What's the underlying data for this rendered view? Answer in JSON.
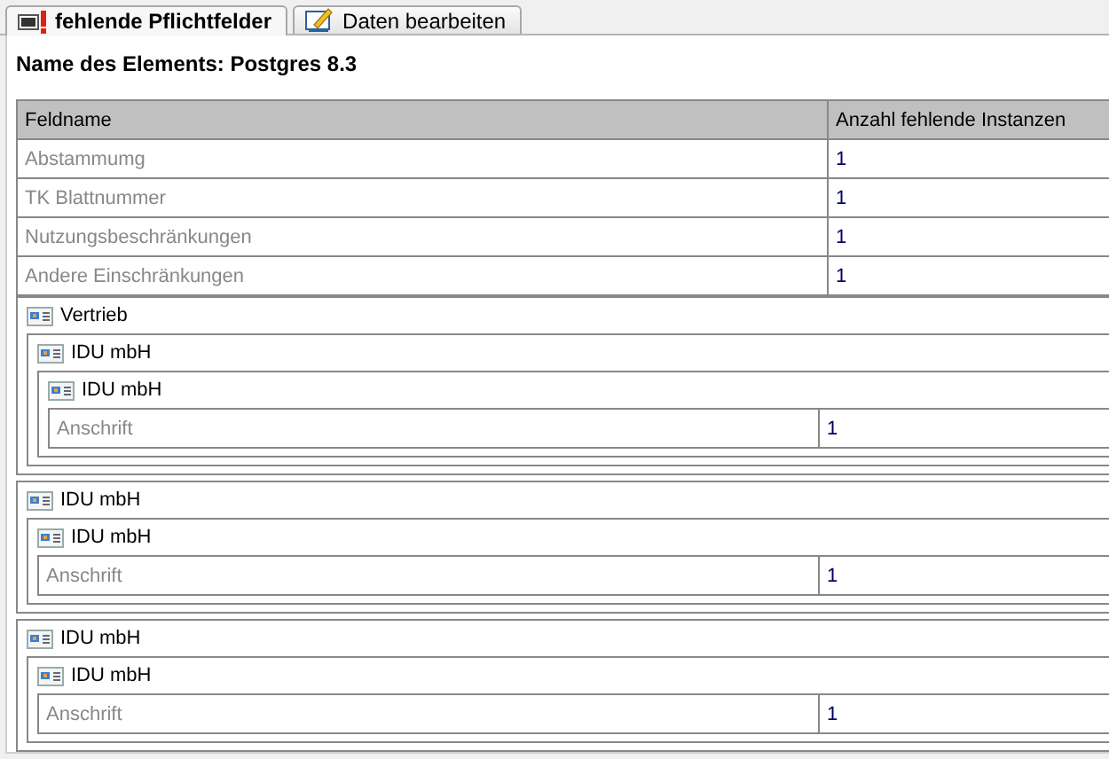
{
  "tabs": [
    {
      "label": "fehlende Pflichtfelder",
      "selected": true,
      "kind": "warning"
    },
    {
      "label": "Daten bearbeiten",
      "selected": false,
      "kind": "edit"
    }
  ],
  "heading": "Name des Elements: Postgres 8.3",
  "table": {
    "columns": [
      "Feldname",
      "Anzahl fehlende Instanzen"
    ],
    "rows": [
      {
        "field": "Abstammumg",
        "count": "1"
      },
      {
        "field": "TK Blattnummer",
        "count": "1"
      },
      {
        "field": "Nutzungsbeschränkungen",
        "count": "1"
      },
      {
        "field": "Andere Einschränkungen",
        "count": "1"
      }
    ]
  },
  "groups": [
    {
      "label": "Vertrieb",
      "children": [
        {
          "label": "IDU mbH",
          "children": [
            {
              "label": "IDU mbH",
              "rows": [
                {
                  "field": "Anschrift",
                  "count": "1"
                }
              ]
            }
          ]
        }
      ]
    },
    {
      "label": "IDU mbH",
      "children": [
        {
          "label": "IDU mbH",
          "rows": [
            {
              "field": "Anschrift",
              "count": "1"
            }
          ]
        }
      ]
    },
    {
      "label": "IDU mbH",
      "children": [
        {
          "label": "IDU mbH",
          "rows": [
            {
              "field": "Anschrift",
              "count": "1"
            }
          ]
        }
      ]
    }
  ]
}
